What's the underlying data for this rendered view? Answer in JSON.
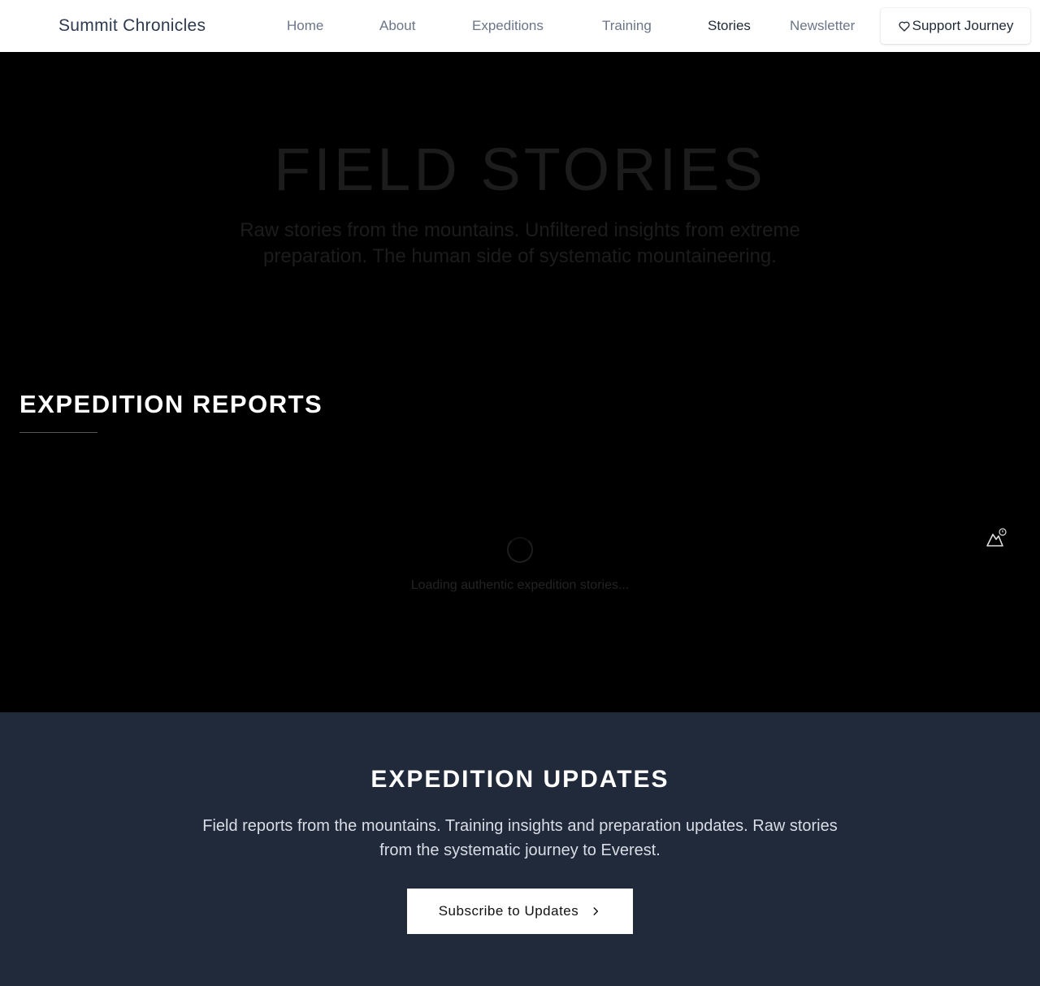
{
  "nav": {
    "brand": "Summit Chronicles",
    "links": [
      "Home",
      "About",
      "Expeditions",
      "Training",
      "Stories",
      "Newsletter"
    ],
    "active": "Stories",
    "support_label": "Support Journey"
  },
  "hero": {
    "title": "FIELD STORIES",
    "subtitle": "Raw stories from the mountains. Unfiltered insights from extreme preparation. The human side of systematic mountaineering."
  },
  "reports": {
    "title": "EXPEDITION REPORTS",
    "loading_text": "Loading authentic expedition stories..."
  },
  "updates": {
    "title": "EXPEDITION UPDATES",
    "text": "Field reports from the mountains. Training insights and preparation updates. Raw stories from the systematic journey to Everest.",
    "button_label": "Subscribe to Updates"
  },
  "icons": {
    "support": "heart-icon",
    "subscribe": "chevron-right-icon",
    "floating": "mountain-icon"
  },
  "colors": {
    "nav_bg": "#ffffff",
    "dark_bg": "#000000",
    "updates_bg": "#212a3a",
    "brand_text": "#2d3a4f"
  }
}
